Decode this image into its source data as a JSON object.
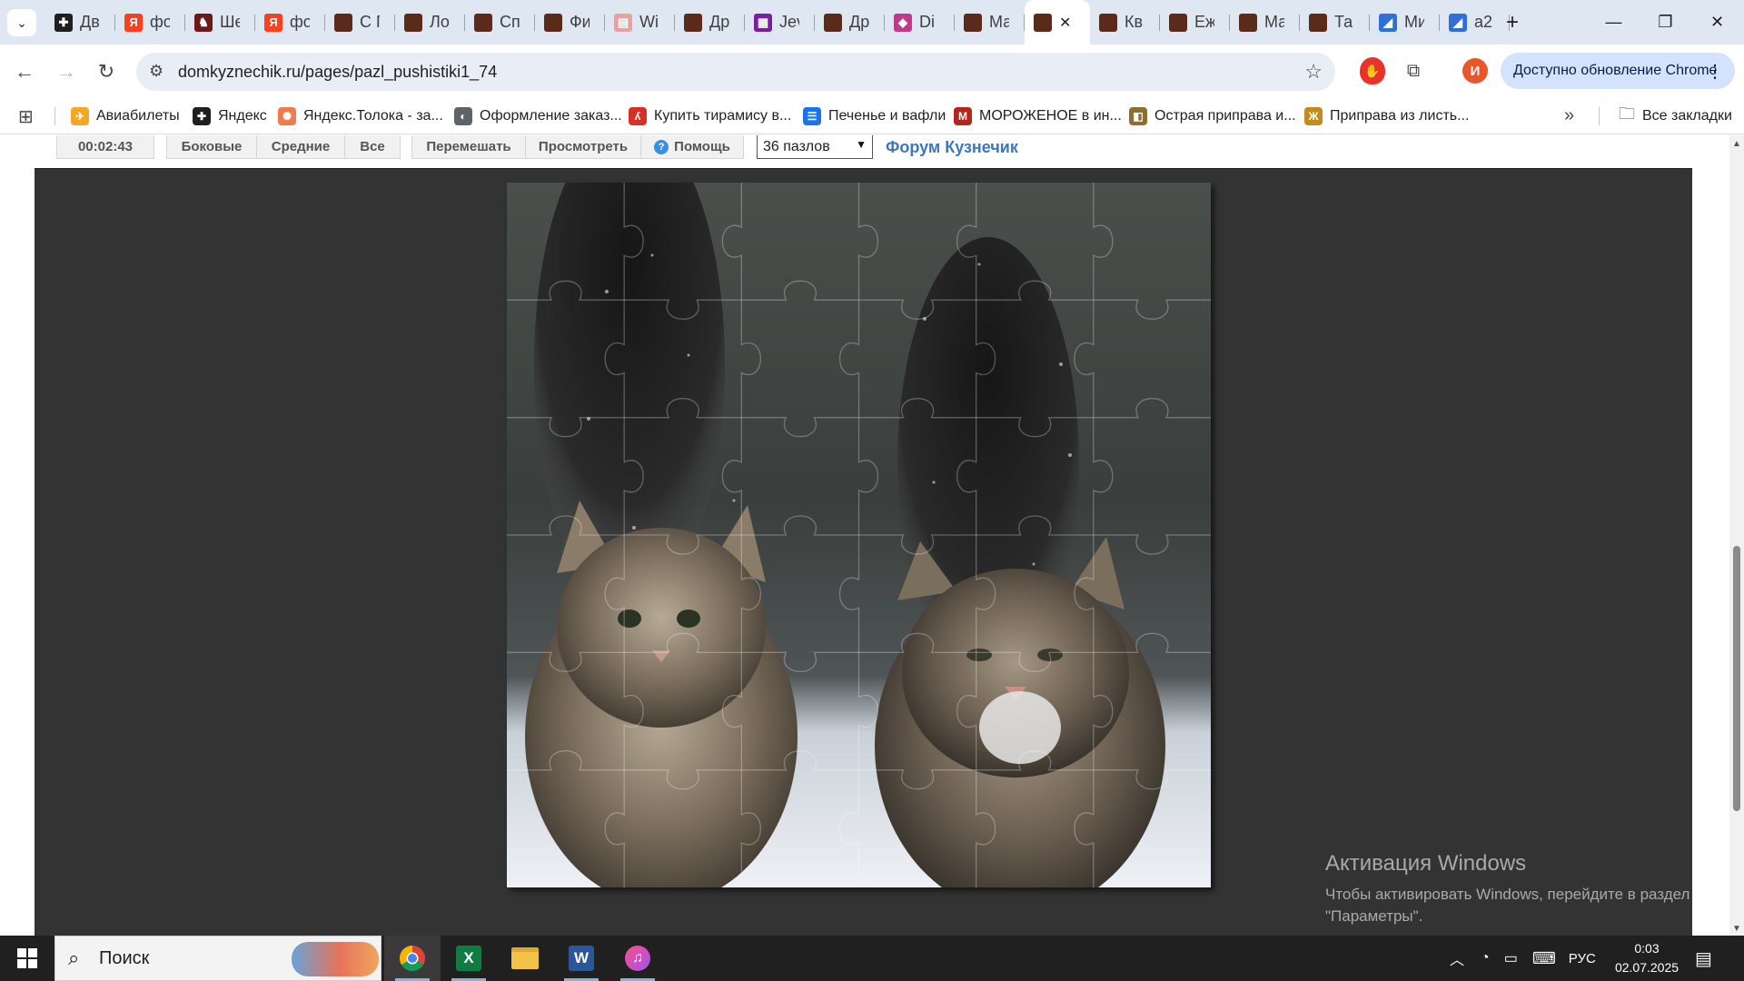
{
  "browser": {
    "tabs": [
      {
        "title": "Дв",
        "favicon_color": "#1f1f1f",
        "glyph": "✚"
      },
      {
        "title": "фо",
        "favicon_color": "#fc3f1d",
        "glyph": "Я"
      },
      {
        "title": "Ше",
        "favicon_color": "#6b1a1a",
        "glyph": "♞"
      },
      {
        "title": "фо",
        "favicon_color": "#fc3f1d",
        "glyph": "Я"
      },
      {
        "title": "С Г",
        "favicon_color": "#5a2a1a",
        "glyph": ""
      },
      {
        "title": "Ло",
        "favicon_color": "#5a2a1a",
        "glyph": ""
      },
      {
        "title": "Сп",
        "favicon_color": "#5a2a1a",
        "glyph": ""
      },
      {
        "title": "Фи",
        "favicon_color": "#5a2a1a",
        "glyph": ""
      },
      {
        "title": "Wi",
        "favicon_color": "#e8a0a0",
        "glyph": "▤"
      },
      {
        "title": "Др",
        "favicon_color": "#5a2a1a",
        "glyph": ""
      },
      {
        "title": "Jev",
        "favicon_color": "#7a1fa2",
        "glyph": "▦"
      },
      {
        "title": "Др",
        "favicon_color": "#5a2a1a",
        "glyph": ""
      },
      {
        "title": "Di",
        "favicon_color": "#c0398a",
        "glyph": "◆"
      },
      {
        "title": "Ма",
        "favicon_color": "#5a2a1a",
        "glyph": ""
      },
      {
        "title": "",
        "favicon_color": "#5a2a1a",
        "glyph": "",
        "active": true
      },
      {
        "title": "Кв",
        "favicon_color": "#5a2a1a",
        "glyph": ""
      },
      {
        "title": "Еж",
        "favicon_color": "#5a2a1a",
        "glyph": ""
      },
      {
        "title": "Ма",
        "favicon_color": "#5a2a1a",
        "glyph": ""
      },
      {
        "title": "Та",
        "favicon_color": "#5a2a1a",
        "glyph": ""
      },
      {
        "title": "Ми",
        "favicon_color": "#2f6fd6",
        "glyph": "◢"
      },
      {
        "title": "а2",
        "favicon_color": "#2f6fd6",
        "glyph": "◢"
      }
    ],
    "url": "domkyznechik.ru/pages/pazl_pushistiki1_74",
    "update_label": "Доступно обновление Chrome",
    "profile_initial": "И",
    "bookmarks": [
      {
        "label": "Авиабилеты",
        "color": "#f5a623",
        "glyph": "✈"
      },
      {
        "label": "Яндекс",
        "color": "#1f1f1f",
        "glyph": "✚"
      },
      {
        "label": "Яндекс.Толока - за...",
        "color": "#f07b4d",
        "glyph": "✺"
      },
      {
        "label": "Оформление заказ...",
        "color": "#5f6368",
        "glyph": "◐"
      },
      {
        "label": "Купить тирамису в...",
        "color": "#d93025",
        "glyph": "ʎ"
      },
      {
        "label": "Печенье и вафли",
        "color": "#1a73e8",
        "glyph": "☰"
      },
      {
        "label": "МОРОЖЕНОЕ в ин...",
        "color": "#b3261e",
        "glyph": "М"
      },
      {
        "label": "Острая приправа и...",
        "color": "#8d6e2f",
        "glyph": "◧"
      },
      {
        "label": "Приправа из листь...",
        "color": "#c58a1b",
        "glyph": "Ж"
      }
    ],
    "all_bookmarks_label": "Все закладки"
  },
  "puzzle": {
    "timer": "00:02:43",
    "buttons": [
      "Боковые",
      "Средние",
      "Все"
    ],
    "actions": [
      "Перемешать",
      "Просмотреть"
    ],
    "help_label": "Помощь",
    "pieces_select": "36 пазлов",
    "forum_link": "Форум Кузнечик",
    "grid_cols": 6,
    "grid_rows": 6
  },
  "activation": {
    "title": "Активация Windows",
    "subtitle_line1": "Чтобы активировать Windows, перейдите в раздел",
    "subtitle_line2": "\"Параметры\"."
  },
  "taskbar": {
    "search_placeholder": "Поиск",
    "lang": "РУС",
    "time": "0:03",
    "date": "02.07.2025"
  }
}
